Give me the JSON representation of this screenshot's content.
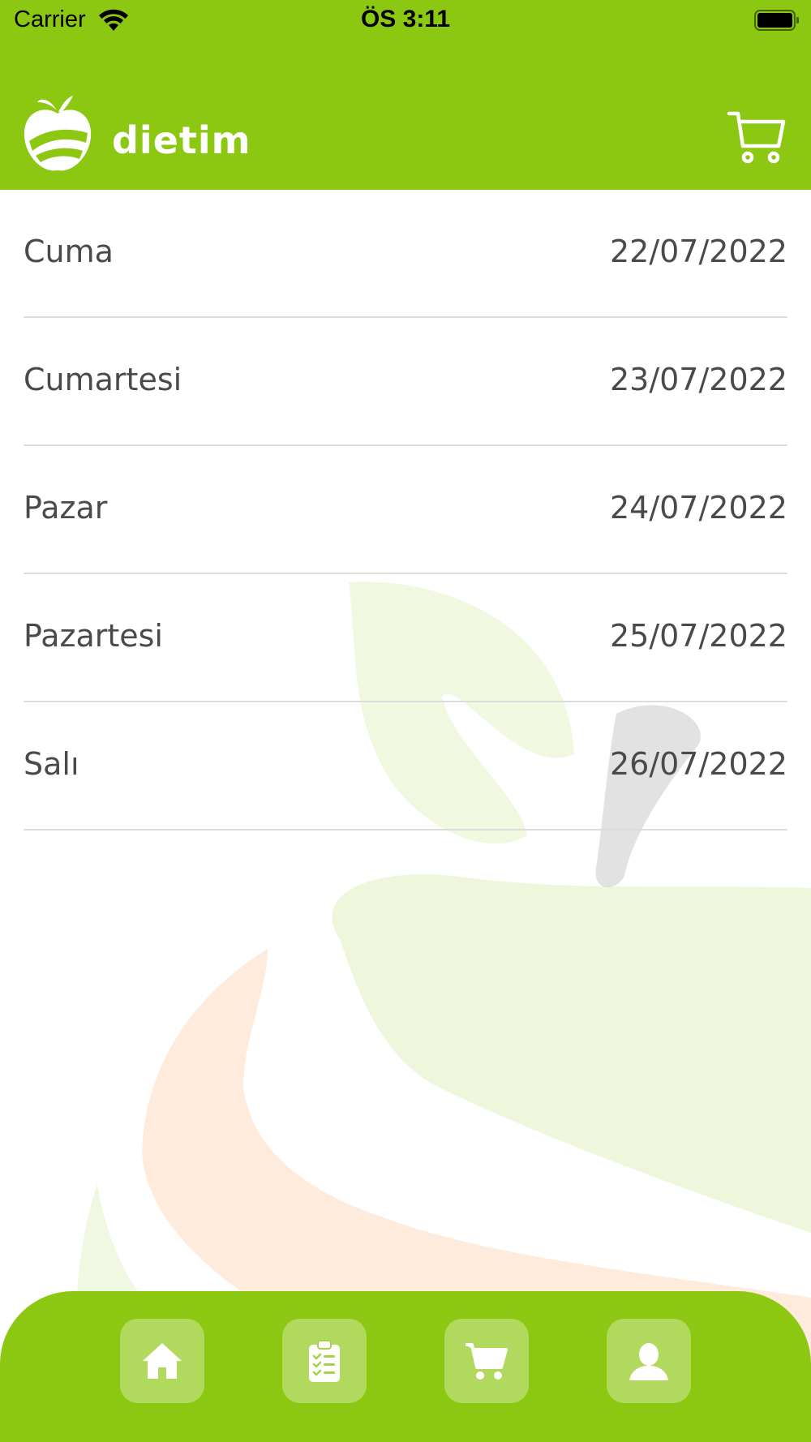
{
  "status_bar": {
    "carrier": "Carrier",
    "time": "ÖS 3:11"
  },
  "header": {
    "brand": "dietim",
    "icons": [
      "apple-logo-icon",
      "cart-icon"
    ]
  },
  "days": [
    {
      "name": "Cuma",
      "date": "22/07/2022"
    },
    {
      "name": "Cumartesi",
      "date": "23/07/2022"
    },
    {
      "name": "Pazar",
      "date": "24/07/2022"
    },
    {
      "name": "Pazartesi",
      "date": "25/07/2022"
    },
    {
      "name": "Salı",
      "date": "26/07/2022"
    }
  ],
  "tab_bar": {
    "tabs": [
      "home-icon",
      "clipboard-list-icon",
      "cart-icon",
      "user-icon"
    ]
  },
  "colors": {
    "brand_green": "#8cc712",
    "text": "#4a4a4a",
    "divider": "#dcdcdc"
  }
}
